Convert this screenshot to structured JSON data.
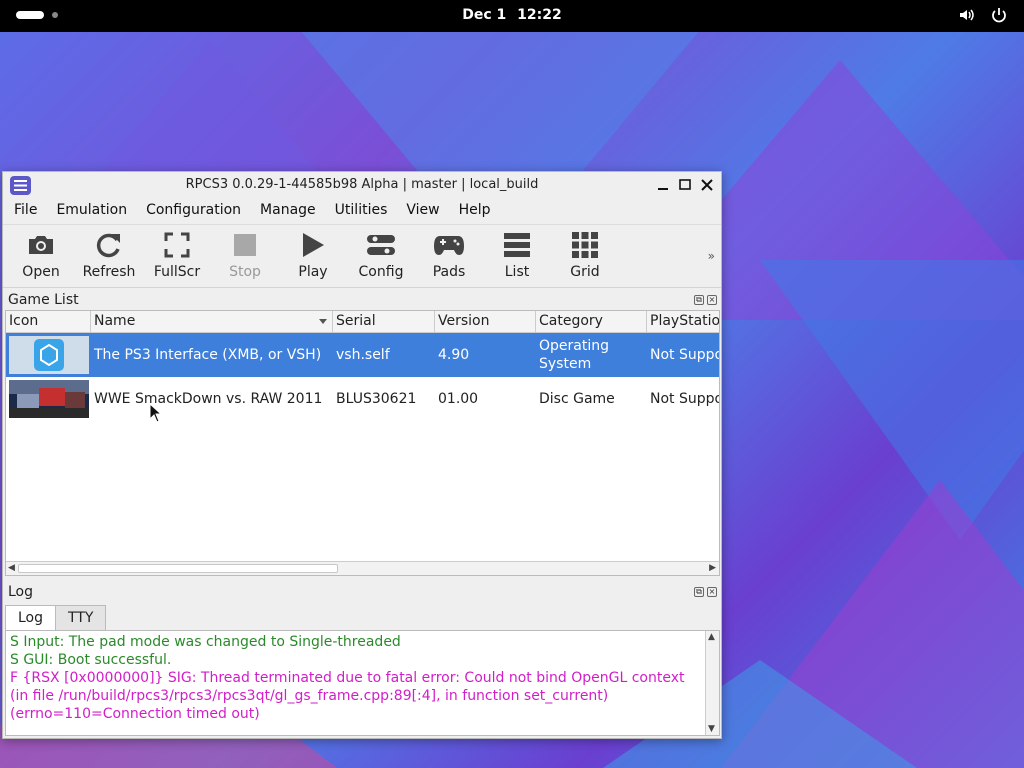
{
  "topbar": {
    "date": "Dec 1",
    "time": "12:22"
  },
  "window": {
    "title": "RPCS3 0.0.29-1-44585b98 Alpha | master | local_build"
  },
  "menu": [
    "File",
    "Emulation",
    "Configuration",
    "Manage",
    "Utilities",
    "View",
    "Help"
  ],
  "toolbar": {
    "open": "Open",
    "refresh": "Refresh",
    "fullscr": "FullScr",
    "stop": "Stop",
    "play": "Play",
    "config": "Config",
    "pads": "Pads",
    "list": "List",
    "grid": "Grid",
    "more": "»"
  },
  "gamelist": {
    "title": "Game List",
    "columns": [
      "Icon",
      "Name",
      "Serial",
      "Version",
      "Category",
      "PlayStation"
    ],
    "rows": [
      {
        "name": "The PS3 Interface (XMB, or VSH)",
        "serial": "vsh.self",
        "version": "4.90",
        "category": "Operating System",
        "playstation": "Not Suppo"
      },
      {
        "name": "WWE SmackDown vs. RAW 2011",
        "serial": "BLUS30621",
        "version": "01.00",
        "category": "Disc Game",
        "playstation": "Not Suppo"
      }
    ]
  },
  "log": {
    "title": "Log",
    "tabs": [
      "Log",
      "TTY"
    ],
    "lines": [
      {
        "text": "S Input: The pad mode was changed to Single-threaded",
        "color": "#2a8a2a"
      },
      {
        "text": "S GUI: Boot successful.",
        "color": "#2a8a2a"
      },
      {
        "text": "F {RSX [0x0000000]} SIG: Thread terminated due to fatal error: Could not bind OpenGL context",
        "color": "#d21ec8"
      },
      {
        "text": "(in file /run/build/rpcs3/rpcs3/rpcs3qt/gl_gs_frame.cpp:89[:4], in function set_current)",
        "color": "#d21ec8"
      },
      {
        "text": "(errno=110=Connection timed out)",
        "color": "#d21ec8"
      }
    ]
  }
}
